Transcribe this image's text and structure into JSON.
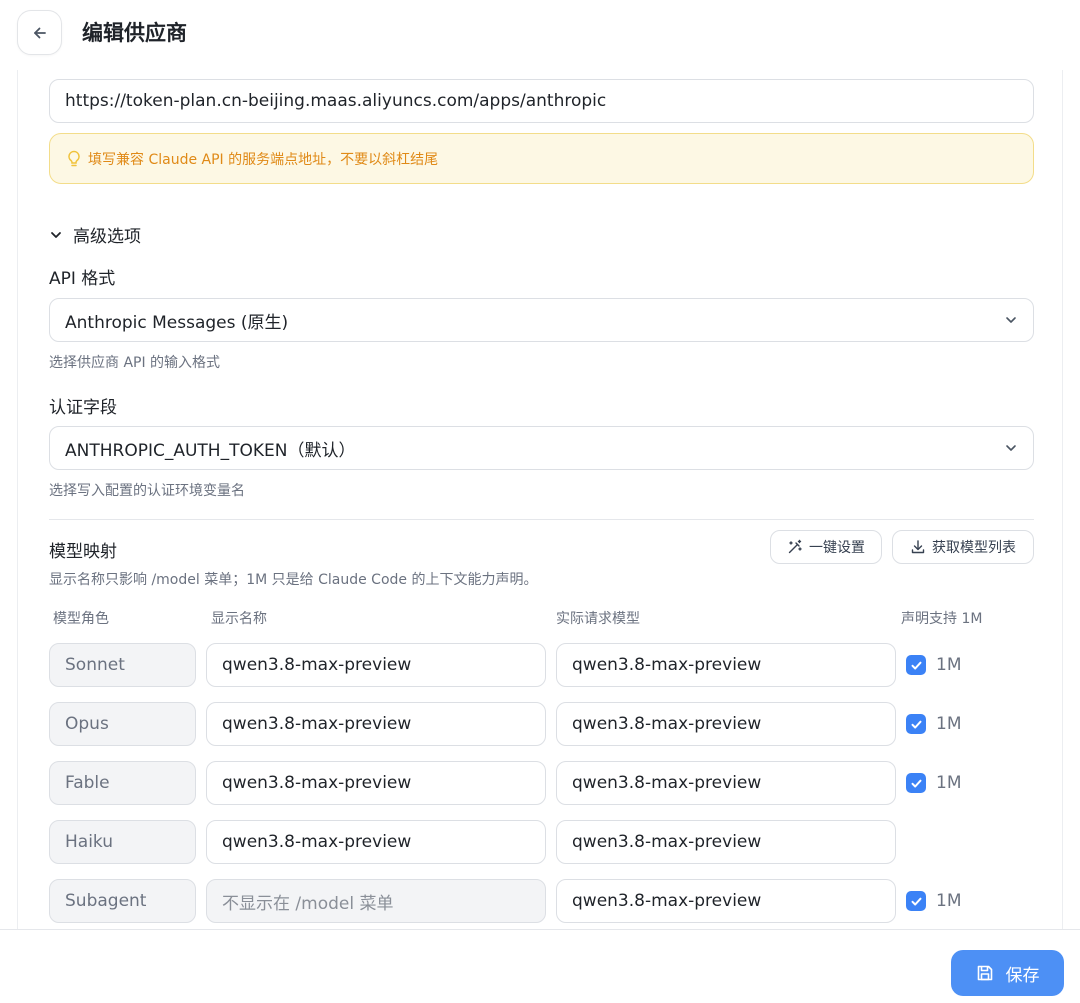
{
  "header": {
    "title": "编辑供应商"
  },
  "endpoint": {
    "value": "https://token-plan.cn-beijing.maas.aliyuncs.com/apps/anthropic",
    "tip": "填写兼容 Claude API 的服务端点地址，不要以斜杠结尾"
  },
  "advanced": {
    "toggle_label": "高级选项",
    "api_format": {
      "label": "API 格式",
      "selected": "Anthropic Messages (原生)",
      "hint": "选择供应商 API 的输入格式"
    },
    "auth_field": {
      "label": "认证字段",
      "selected": "ANTHROPIC_AUTH_TOKEN（默认）",
      "hint": "选择写入配置的认证环境变量名"
    }
  },
  "model_mapping": {
    "title": "模型映射",
    "description": "显示名称只影响 /model 菜单；1M 只是给 Claude Code 的上下文能力声明。",
    "one_click_label": "一键设置",
    "fetch_models_label": "获取模型列表",
    "columns": {
      "role": "模型角色",
      "display_name": "显示名称",
      "actual_model": "实际请求模型",
      "support_1m": "声明支持 1M"
    },
    "rows": [
      {
        "role": "Sonnet",
        "display_name": "qwen3.8-max-preview",
        "actual_model": "qwen3.8-max-preview",
        "checked": true,
        "check_label": "1M"
      },
      {
        "role": "Opus",
        "display_name": "qwen3.8-max-preview",
        "actual_model": "qwen3.8-max-preview",
        "checked": true,
        "check_label": "1M"
      },
      {
        "role": "Fable",
        "display_name": "qwen3.8-max-preview",
        "actual_model": "qwen3.8-max-preview",
        "checked": true,
        "check_label": "1M"
      },
      {
        "role": "Haiku",
        "display_name": "qwen3.8-max-preview",
        "actual_model": "qwen3.8-max-preview",
        "checked": false,
        "check_label": ""
      },
      {
        "role": "Subagent",
        "display_name": "",
        "display_placeholder": "不显示在 /model 菜单",
        "actual_model": "qwen3.8-max-preview",
        "checked": true,
        "check_label": "1M"
      }
    ]
  },
  "footer": {
    "save_label": "保存"
  },
  "colors": {
    "accent": "#4d90f5",
    "checkbox": "#3b82f6",
    "tip_text": "#e08a17",
    "tip_bg": "#fdf8e4"
  },
  "icons": {
    "back": "arrow-left-icon",
    "tip": "lightbulb-icon",
    "toggle": "chevron-down-icon",
    "select": "chevron-down-icon",
    "one_click": "magic-wand-icon",
    "fetch": "download-icon",
    "checkbox": "check-icon",
    "save": "save-icon"
  }
}
